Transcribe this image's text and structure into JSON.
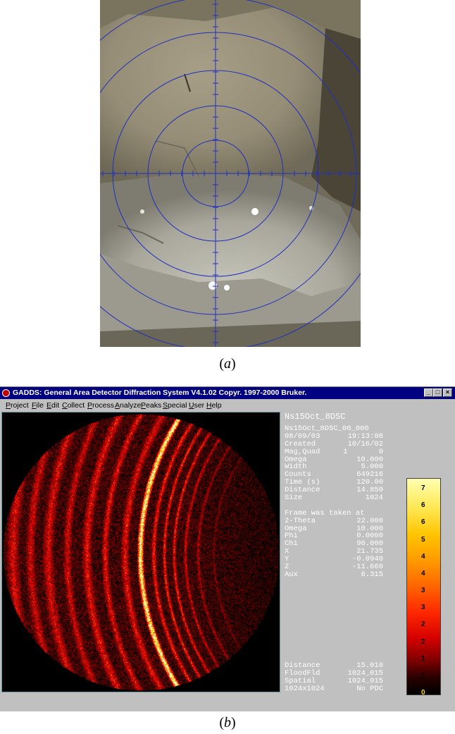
{
  "panel_a": {
    "caption_label": "a"
  },
  "panel_b": {
    "caption_label": "b",
    "window_title": "GADDS: General Area Detector Diffraction System V4.1.02  Copyr. 1997-2000 Bruker.",
    "menu": [
      "Project",
      "File",
      "Edit",
      "Collect",
      "Process",
      "Analyze",
      "Peaks",
      "Special",
      "User",
      "Help"
    ],
    "frame_name": "Ns15Oct_8DSC",
    "frame_info": [
      {
        "label": "Ns15Oct_8DSC_00_000",
        "value": ""
      },
      {
        "label": "08/09/03",
        "value": "19:13:08"
      },
      {
        "label": "Created",
        "value": "10/16/02"
      },
      {
        "label": "Mag,Quad",
        "value": "1       0"
      },
      {
        "label": "Omega",
        "value": "10.000"
      },
      {
        "label": "Width",
        "value": "5.000"
      },
      {
        "label": "Counts",
        "value": "649216"
      },
      {
        "label": "Time (s)",
        "value": "120.00"
      },
      {
        "label": "Distance",
        "value": "14.850"
      },
      {
        "label": "Size",
        "value": "1024"
      },
      {
        "label": "",
        "value": ""
      },
      {
        "label": "Frame was taken at",
        "value": ""
      },
      {
        "label": "2-Theta",
        "value": "22.000"
      },
      {
        "label": "Omega",
        "value": "10.000"
      },
      {
        "label": "Phi",
        "value": "0.0000"
      },
      {
        "label": "Chi",
        "value": "90.000"
      },
      {
        "label": "X",
        "value": "21.735"
      },
      {
        "label": "Y",
        "value": "-0.0940"
      },
      {
        "label": "Z",
        "value": "-11.660"
      },
      {
        "label": "Aux",
        "value": "6.315"
      }
    ],
    "footer_info": [
      {
        "label": "Distance",
        "value": "15.010"
      },
      {
        "label": "FloodFld",
        "value": "1024_015"
      },
      {
        "label": "Spatial",
        "value": "1024_015"
      },
      {
        "label": "1024x1024",
        "value": "No PDC"
      }
    ],
    "colorbar_labels": [
      "7",
      "6",
      "6",
      "5",
      "4",
      "4",
      "3",
      "3",
      "2",
      "2",
      "1",
      "1",
      "0"
    ],
    "colors": {
      "title_bar": "#000080",
      "window_bg": "#c0c0c0",
      "frame_bg": "#000000"
    }
  }
}
